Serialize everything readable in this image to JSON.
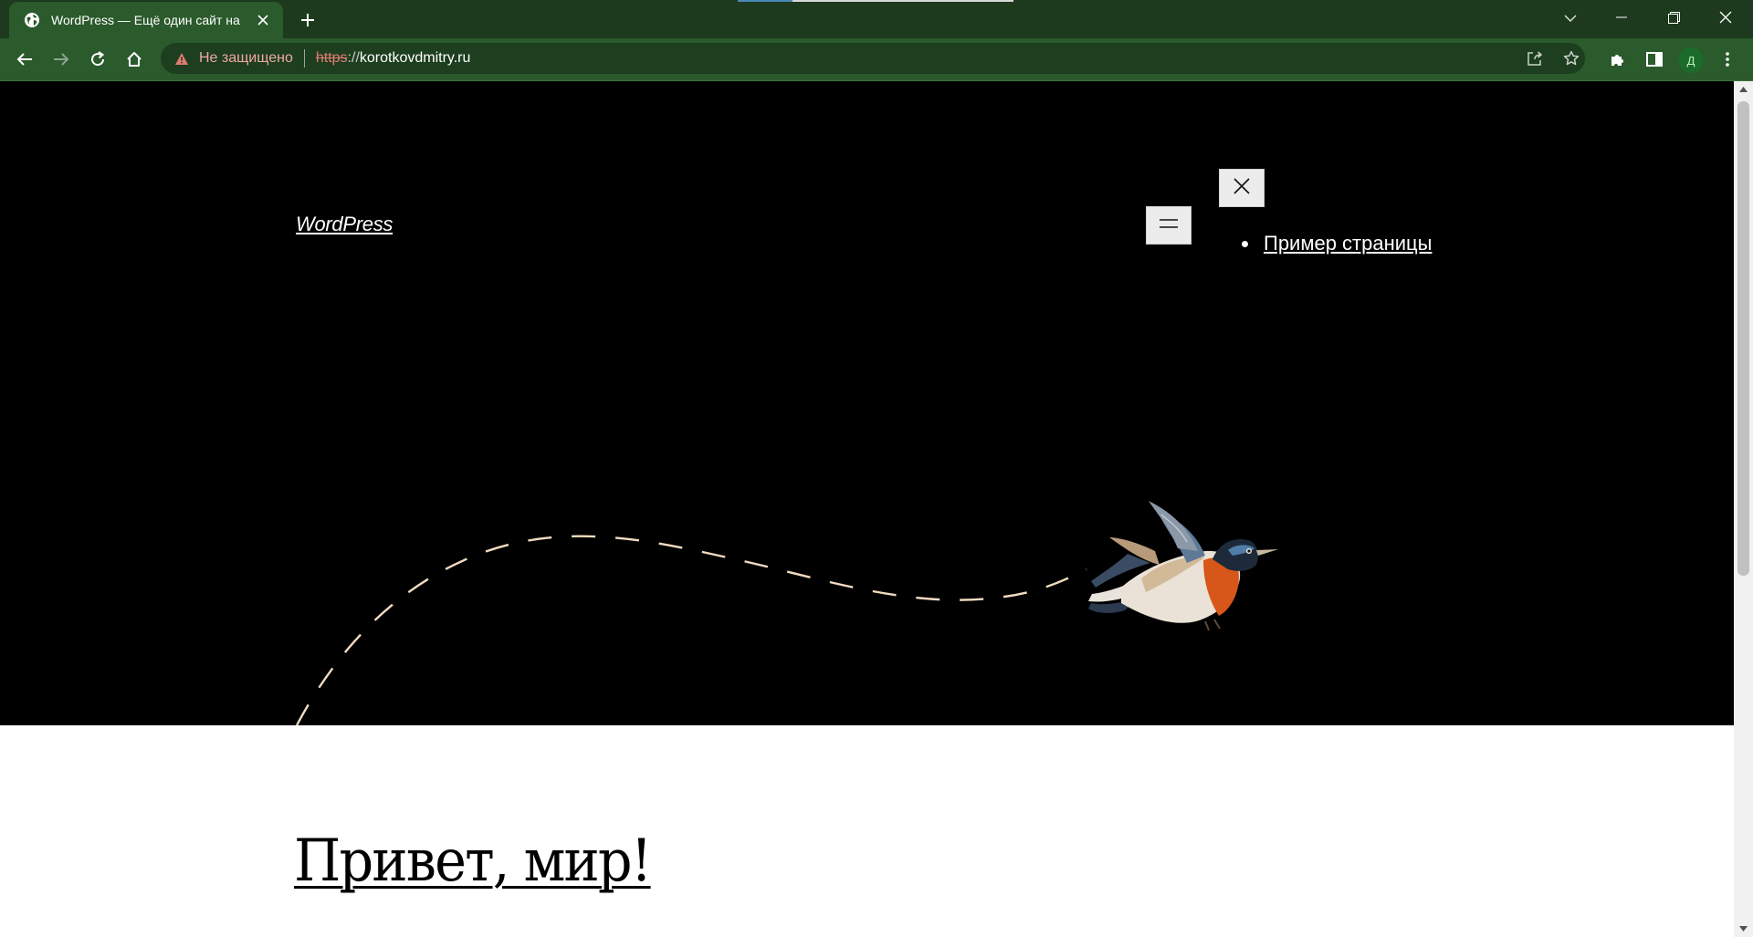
{
  "browser": {
    "tab": {
      "title": "WordPress — Ещё один сайт на",
      "favicon": "globe-icon"
    },
    "address_bar": {
      "security_label": "Не защищено",
      "url_scheme": "https",
      "url_separator": "://",
      "url_host": "korotkovdmitry.ru"
    },
    "profile_initial": "Д",
    "colors": {
      "frame": "#1d3a1e",
      "toolbar": "#2b5a2d",
      "omnibox": "#1d3e1f",
      "warning": "#e07c72"
    }
  },
  "page": {
    "site_title": "WordPress",
    "nav": {
      "items": [
        {
          "label": "Пример страницы"
        }
      ]
    },
    "post_title": "Привет, мир!",
    "colors": {
      "hero_background": "#000000",
      "flight_path": "#f2dcc0",
      "content_background": "#ffffff"
    }
  }
}
